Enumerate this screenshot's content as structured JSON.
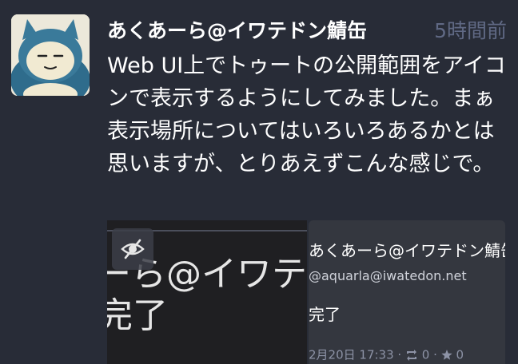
{
  "status": {
    "display_name": "あくあーら@イワテドン鯖缶",
    "timestamp": "5時間前",
    "content": "Web UI上でトゥートの公開範囲をアイコンで表示するようにしてみました。まぁ表示場所についてはいろいろあるかとは思いますが、とりあえずこんな感じで。",
    "avatar_icon": "snorlax-avatar-icon"
  },
  "media": {
    "left_image": {
      "text_line1": "ーら@イワテド",
      "text_line2": "完了",
      "hide_button_icon": "eye-slash-icon"
    },
    "right_image": {
      "display_name": "あくあーら@イワテドン鯖缶",
      "handle": "@aquarla@iwatedon.net",
      "text": "完了",
      "time": "2月20日 17:33",
      "boost_count": "0",
      "fav_count": "0",
      "separator": "·",
      "boost_icon": "boost-icon",
      "fav_icon": "star-icon"
    }
  },
  "colors": {
    "background": "#282c37",
    "muted": "#606984",
    "text": "#ffffff"
  }
}
